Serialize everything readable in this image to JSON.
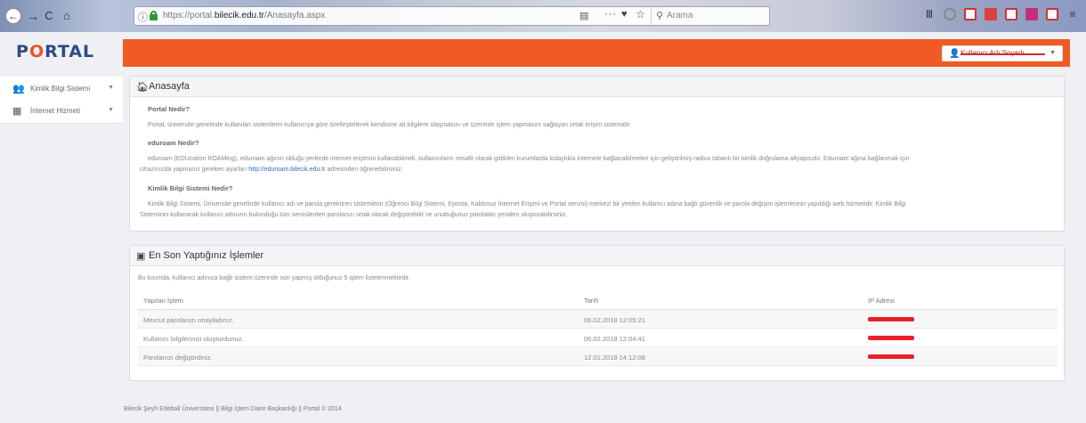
{
  "browser": {
    "url_prefix": "https://portal.",
    "url_domain": "bilecik.edu.tr",
    "url_path": "/Anasayfa.aspx",
    "search_placeholder": "Arama"
  },
  "sidebar": {
    "logo": "PORTAL",
    "items": [
      {
        "label": "Kimlik Bilgi Sistemi"
      },
      {
        "label": "İnternet Hizmeti"
      }
    ]
  },
  "topbar": {
    "user_name": "Kullanıcı Adı Soyadı"
  },
  "home_panel": {
    "title": "Anasayfa",
    "sections": [
      {
        "heading": "Portal Nedir?",
        "lines": [
          "Portal, üniversite genelinde kullanılan sistemlerin kullanıcıya göre özelleştirilerek kendisine ait bilgilere ulaşmasını ve üzerinde işlem yapmasını sağlayan ortak erişim sistemidir."
        ]
      },
      {
        "heading": "eduroam Nedir?",
        "lines": [
          "eduroam (EDUcation ROAMing), eduroam ağının olduğu yerlerde internet erişimini kullanabilmek, kullanıcıların misafir olarak gittikleri kurumlarda kolaylıkla internete bağlanabilmeleri için geliştirilmiş radius tabanlı bir kimlik doğrulama altyapısıdır. Eduroam ağına bağlanmak için",
          "cihazınızda yapmanız gereken ayarları"
        ],
        "link": "http://eduroam.bilecik.edu.tr",
        "after_link": "adresinden öğrenebilirsiniz."
      },
      {
        "heading": "Kimlik Bilgi Sistemi Nedir?",
        "lines": [
          "Kimlik Bilgi Sistemi, Üniversite genelinde kullanıcı adı ve parola gerektiren sistemlerin (Öğrenci Bilgi Sistemi, Eposta, Kablosuz İnternet Erişimi ve Portal servisi) merkezi bir yerden kullanıcı adına bağlı güvenlik ve parola değişim işlemlerinin yapıldığı web hizmetidir. Kimlik Bilgi",
          "Sisteminin kullanarak kullanıcı adınızın bulunduğu tüm servislerden parolanızı ortak olarak değiştirebilir ve unuttuğunuz parolaları yeniden oluşturabilirsiniz."
        ]
      }
    ]
  },
  "recent_panel": {
    "title": "En Son Yaptığınız İşlemler",
    "description": "Bu kısımda, kullanıcı adınıza bağlı sistem üzerinde son yapmış olduğunuz 5 işlem listelenmektedir.",
    "columns": [
      "Yapılan İşlem",
      "Tarih",
      "IP Adresi"
    ],
    "rows": [
      {
        "action": "Mevcut parolanızı onayladınız.",
        "date": "06.02.2018 12:05:21"
      },
      {
        "action": "Kullanıcı bilgilerinizi oluşturdunuz.",
        "date": "06.02.2018 12:04:41"
      },
      {
        "action": "Parolanızı değiştirdiniz.",
        "date": "12.01.2018 14:12:08"
      }
    ]
  },
  "footer": {
    "text": "Bilecik Şeyh Edebali Üniversitesi || Bilgi İşlem Daire Başkanlığı || Portal © 2014"
  }
}
